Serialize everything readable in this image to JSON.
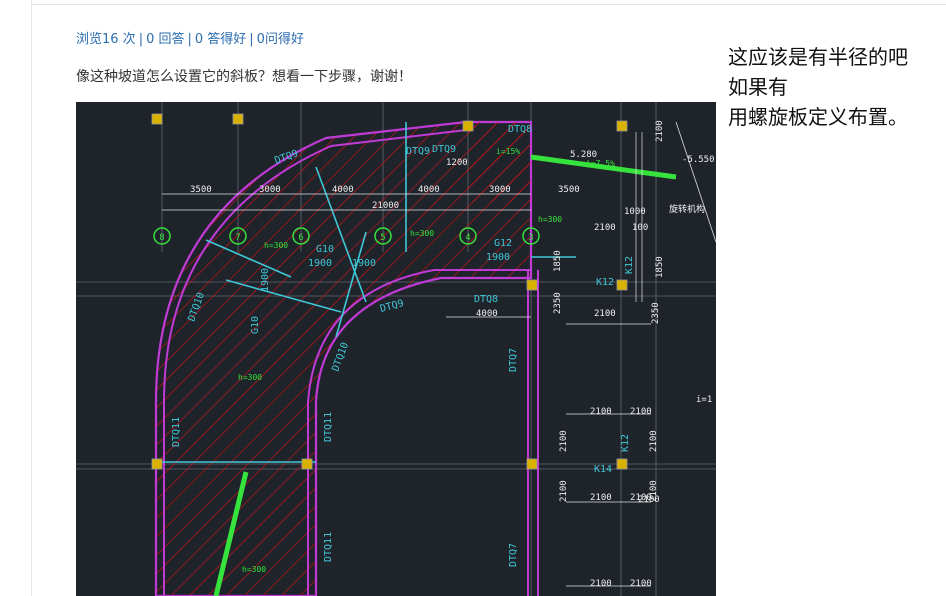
{
  "post": {
    "stats": {
      "views": "浏览16 次",
      "answers": "0 回答",
      "good_answers": "0 答得好",
      "good_questions": "0问得好",
      "separator": "|"
    },
    "question": "像这种坡道怎么设置它的斜板？想看一下步骤，谢谢！"
  },
  "drawing": {
    "labels": {
      "dtq9_a": "DTQ9",
      "dtq9_b": "DTQ9",
      "dtq9_c": "DTQ9",
      "dtq9_d": "DTQ9",
      "dtq8_a": "DTQ8",
      "dtq8_b": "DTQ8",
      "dtq10_a": "DTQ10",
      "dtq10_b": "DTQ10",
      "dtq11_a": "DTQ11",
      "dtq11_b": "DTQ11",
      "dtq11_c": "DTQ11",
      "dtq7_a": "DTQ7",
      "dtq7_b": "DTQ7",
      "g10_a": "G10",
      "g10_b": "G10",
      "g12": "G12",
      "k12_a": "K12",
      "k12_b": "K12",
      "k12_c": "K12",
      "k14": "K14",
      "dim_3500_a": "3500",
      "dim_3000_a": "3000",
      "dim_4000_a": "4000",
      "dim_4000_b": "4000",
      "dim_3000_b": "3000",
      "dim_3500_b": "3500",
      "dim_21000": "21000",
      "dim_1200": "1200",
      "dim_1900_a": "1900",
      "dim_1900_b": "1900",
      "dim_1900_c": "1900",
      "dim_1900_d": "1900",
      "dim_4000_c": "4000",
      "dim_2100_a": "2100",
      "dim_2100_b": "2100",
      "dim_2100_c": "2100",
      "dim_2100_d": "2100",
      "dim_2100_e": "2100",
      "dim_2100_f": "2100",
      "dim_2100_g": "2100",
      "dim_2100_h": "2100",
      "dim_2100_i": "2100",
      "dim_2100_j": "2100",
      "dim_2100_k": "2100",
      "dim_2100_l": "2100",
      "dim_2100_m": "2100",
      "dim_2100_n": "2100",
      "dim_1850_a": "1850",
      "dim_1850_b": "1850",
      "dim_2350": "2350",
      "dim_2350_b": "2350",
      "dim_5280": "5.280",
      "dim_5550": "-5.550",
      "dim_1000": "1000",
      "dim_100": "100",
      "slope_a": "i=15%",
      "slope_b": "i=7.5%",
      "slope_c": "i=1",
      "h300_a": "h=300",
      "h300_b": "h=300",
      "h300_c": "h=300",
      "h300_d": "h=300",
      "h300_e": "h=300",
      "axis_a": "8",
      "axis_b": "7",
      "axis_c": "6",
      "axis_d": "5",
      "axis_e": "4",
      "axis_f": "3",
      "side_note": "旋转机构"
    }
  },
  "answer": {
    "line1": "这应该是有半径的吧",
    "line2": "如果有",
    "line3": "用螺旋板定义布置。"
  }
}
